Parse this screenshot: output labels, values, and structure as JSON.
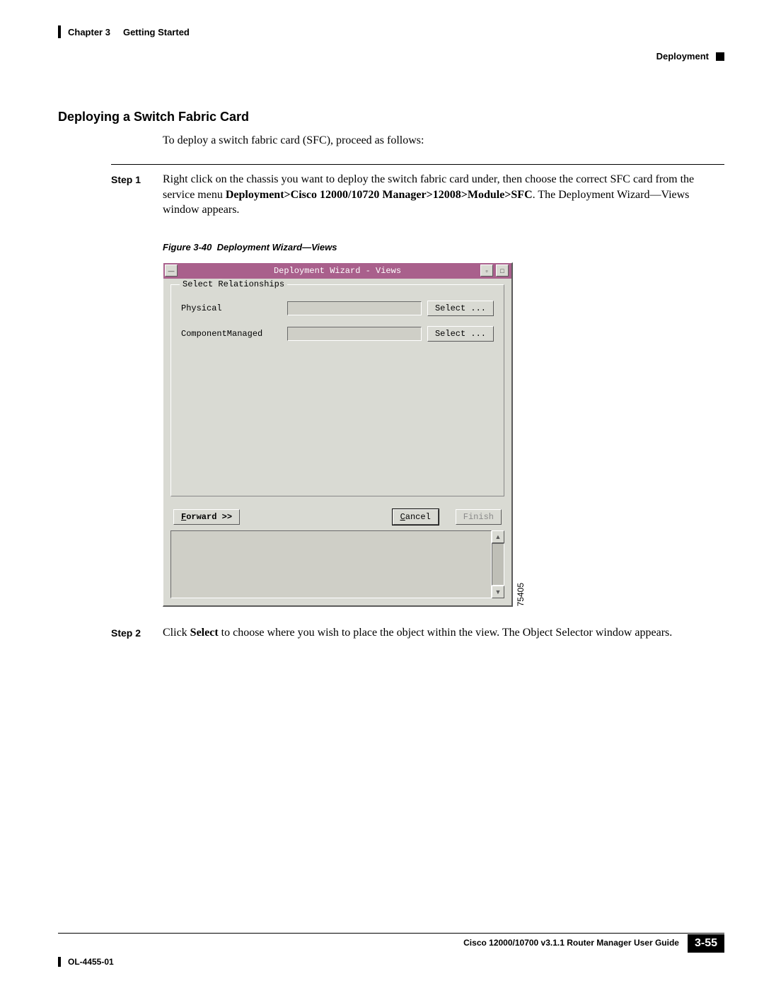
{
  "header": {
    "chapter": "Chapter 3",
    "chapter_title": "Getting Started",
    "right_label": "Deployment"
  },
  "section": {
    "title": "Deploying a Switch Fabric Card",
    "intro": "To deploy a switch fabric card (SFC), proceed as follows:"
  },
  "step1": {
    "label": "Step 1",
    "pre": "Right click on the chassis you want to deploy the switch fabric card under, then choose the correct SFC card from the service menu ",
    "bold": "Deployment>Cisco 12000/10720 Manager>12008>Module>SFC",
    "post": ". The Deployment Wizard—Views window appears."
  },
  "figure": {
    "label": "Figure 3-40",
    "title": "Deployment Wizard—Views",
    "image_id": "75405"
  },
  "wizard": {
    "window_title": "Deployment Wizard - Views",
    "group_label": "Select Relationships",
    "rows": [
      {
        "label": "Physical",
        "btn": "Select ..."
      },
      {
        "label": "ComponentManaged",
        "btn": "Select ..."
      }
    ],
    "forward_btn": "Forward >>",
    "cancel_btn": "Cancel",
    "finish_btn": "Finish"
  },
  "step2": {
    "label": "Step 2",
    "pre": "Click ",
    "bold": "Select",
    "post": " to choose where you wish to place the object within the view. The Object Selector window appears."
  },
  "footer": {
    "guide": "Cisco 12000/10700 v3.1.1 Router Manager User Guide",
    "doc_id": "OL-4455-01",
    "page": "3-55"
  }
}
